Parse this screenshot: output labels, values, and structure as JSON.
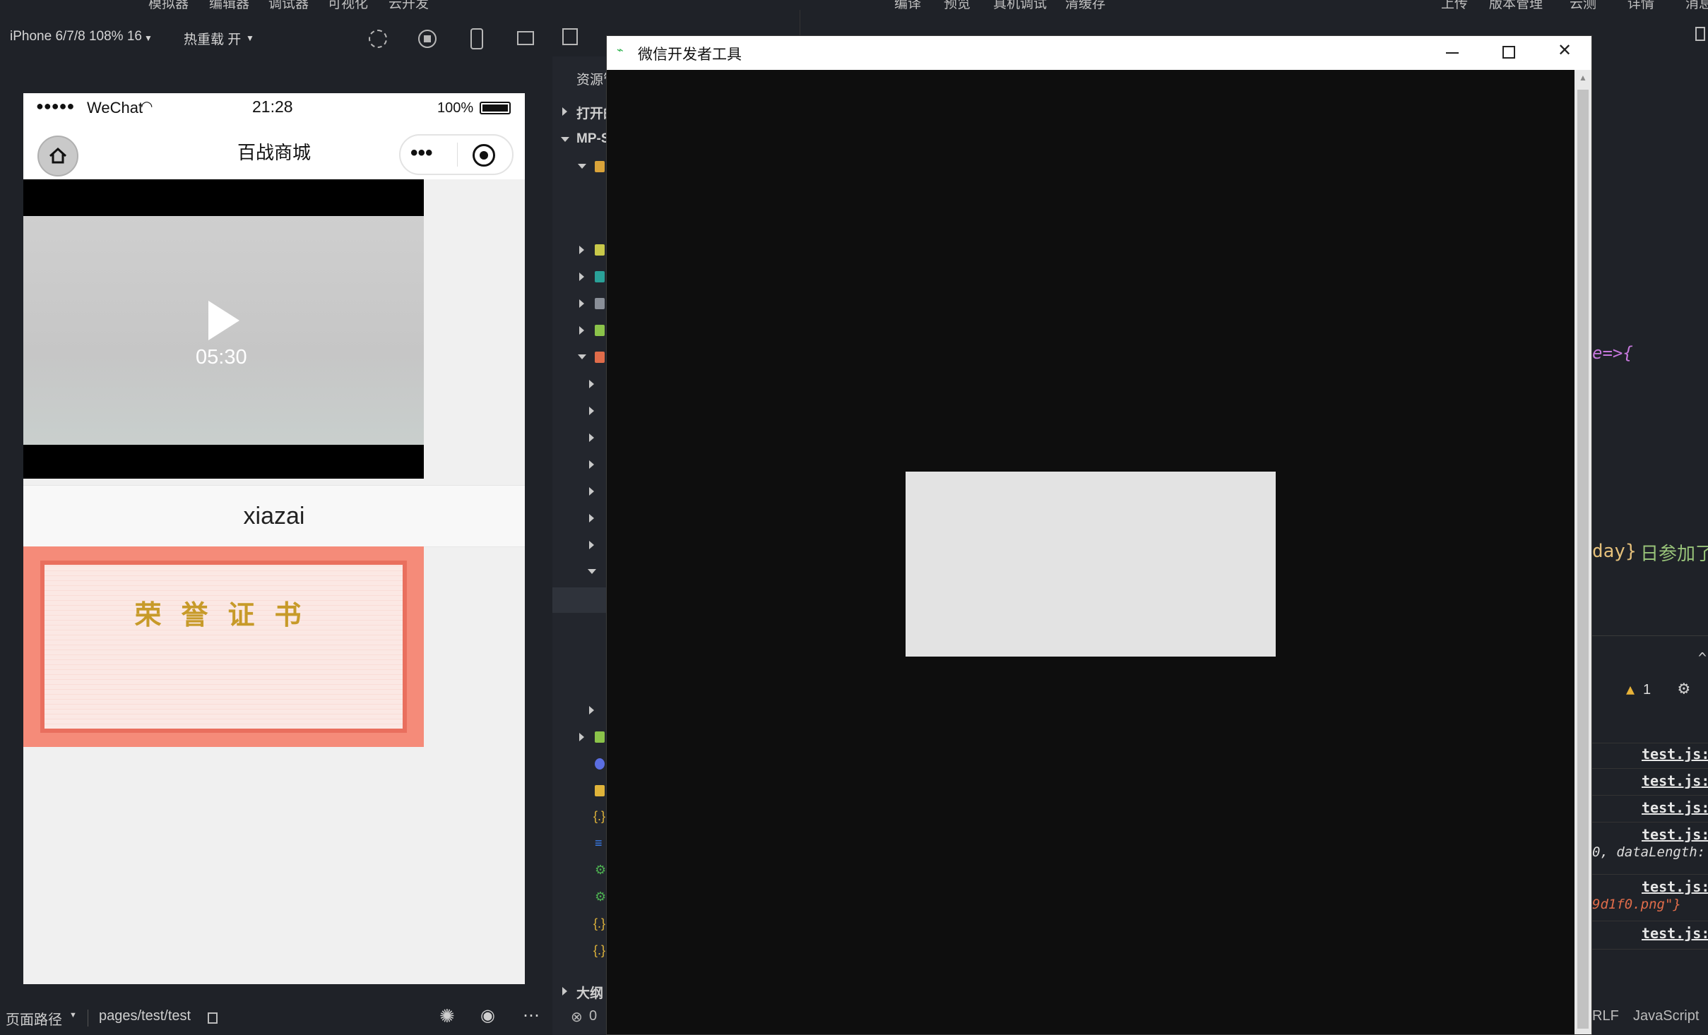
{
  "top_menu": {
    "left": [
      "模拟器",
      "编辑器",
      "调试器",
      "可视化",
      "云开发"
    ],
    "middle": [
      "编译",
      "预览",
      "真机调试",
      "清缓存"
    ],
    "right": [
      "上传",
      "版本管理",
      "云测",
      "详情",
      "消息"
    ]
  },
  "simulator_toolbar": {
    "device_label": "iPhone 6/7/8 108% 16",
    "hot_reload_label": "热重载 开"
  },
  "phone": {
    "status": {
      "signal": "●●●●●",
      "carrier": "WeChat",
      "time": "21:28",
      "battery": "100%"
    },
    "nav_title": "百战商城",
    "capsule_more": "•••",
    "video": {
      "duration": "05:30"
    },
    "download_button": "xiazai",
    "certificate_title": "荣誉证书"
  },
  "bottom_bar": {
    "path_label": "页面路径",
    "path_value": "pages/test/test"
  },
  "explorer": {
    "resource_label": "资源管",
    "open_editors_label": "打开的",
    "project_label": "MP-S",
    "outline_label": "大纲",
    "errors_count": "0"
  },
  "dialog": {
    "title": "微信开发者工具"
  },
  "code_fragments": {
    "line1": "e=>{",
    "line2_var": "day}",
    "line2_text": " 日参加了"
  },
  "console": {
    "warning_count": "1",
    "entries": [
      "test.js:",
      "test.js:",
      "test.js:",
      "test.js:",
      "test.js:",
      "test.js:"
    ],
    "sub1": "0, dataLength:",
    "sub2": "9d1f0.png\"}"
  },
  "status_bar_right": {
    "eol": "RLF",
    "language": "JavaScript"
  },
  "colors": {
    "warning": "#e8b339",
    "keyword": "#c678dd",
    "string": "#98c379",
    "link": "#e6e6e6"
  }
}
